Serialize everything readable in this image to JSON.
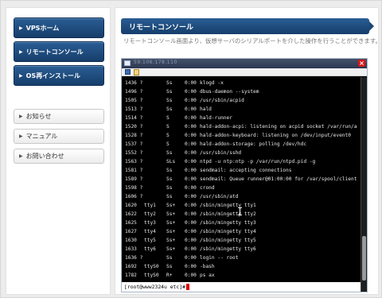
{
  "sidebar": {
    "nav": [
      {
        "label": "VPSホーム"
      },
      {
        "label": "リモートコンソール"
      },
      {
        "label": "OS再インストール"
      }
    ],
    "sub": [
      {
        "label": "お知らせ"
      },
      {
        "label": "マニュアル"
      },
      {
        "label": "お問い合わせ"
      }
    ]
  },
  "main": {
    "title": "リモートコンソール",
    "description": "リモートコンソール画面より、仮想サーバのシリアルポートを介した操作を行うことができます。"
  },
  "console": {
    "window_title": "59.106.178.110",
    "processes": [
      {
        "pid": "1436 ?",
        "tty": "",
        "stat": "Ss",
        "time": "0:00",
        "cmd": "klogd -x"
      },
      {
        "pid": "1496 ?",
        "tty": "",
        "stat": "Ss",
        "time": "0:00",
        "cmd": "dbus-daemon --system"
      },
      {
        "pid": "1505 ?",
        "tty": "",
        "stat": "Ss",
        "time": "0:00",
        "cmd": "/usr/sbin/acpid"
      },
      {
        "pid": "1513 ?",
        "tty": "",
        "stat": "Ss",
        "time": "0:00",
        "cmd": "hald"
      },
      {
        "pid": "1514 ?",
        "tty": "",
        "stat": "S",
        "time": "0:00",
        "cmd": "hald-runner"
      },
      {
        "pid": "1520 ?",
        "tty": "",
        "stat": "S",
        "time": "0:00",
        "cmd": "hald-addon-acpi: listening on acpid socket /var/run/a"
      },
      {
        "pid": "1528 ?",
        "tty": "",
        "stat": "S",
        "time": "0:00",
        "cmd": "hald-addon-keyboard: listening on /dev/input/event0"
      },
      {
        "pid": "1537 ?",
        "tty": "",
        "stat": "S",
        "time": "0:00",
        "cmd": "hald-addon-storage: polling /dev/hdc"
      },
      {
        "pid": "1552 ?",
        "tty": "",
        "stat": "Ss",
        "time": "0:00",
        "cmd": "/usr/sbin/sshd"
      },
      {
        "pid": "1563 ?",
        "tty": "",
        "stat": "SLs",
        "time": "0:00",
        "cmd": "ntpd -u ntp:ntp -p /var/run/ntpd.pid -g"
      },
      {
        "pid": "1581 ?",
        "tty": "",
        "stat": "Ss",
        "time": "0:00",
        "cmd": "sendmail: accepting connections"
      },
      {
        "pid": "1589 ?",
        "tty": "",
        "stat": "Ss",
        "time": "0:00",
        "cmd": "sendmail: Queue runner@01:00:00 for /var/spool/client"
      },
      {
        "pid": "1598 ?",
        "tty": "",
        "stat": "Ss",
        "time": "0:00",
        "cmd": "crond"
      },
      {
        "pid": "1606 ?",
        "tty": "",
        "stat": "Ss",
        "time": "0:00",
        "cmd": "/usr/sbin/atd"
      },
      {
        "pid": "1620",
        "tty": "tty1",
        "stat": "Ss+",
        "time": "0:00",
        "cmd": "/sbin/mingetty tty1"
      },
      {
        "pid": "1622",
        "tty": "tty2",
        "stat": "Ss+",
        "time": "0:00",
        "cmd": "/sbin/mingetty tty2"
      },
      {
        "pid": "1625",
        "tty": "tty3",
        "stat": "Ss+",
        "time": "0:00",
        "cmd": "/sbin/mingetty tty3"
      },
      {
        "pid": "1627",
        "tty": "tty4",
        "stat": "Ss+",
        "time": "0:00",
        "cmd": "/sbin/mingetty tty4"
      },
      {
        "pid": "1630",
        "tty": "tty5",
        "stat": "Ss+",
        "time": "0:00",
        "cmd": "/sbin/mingetty tty5"
      },
      {
        "pid": "1633",
        "tty": "tty6",
        "stat": "Ss+",
        "time": "0:00",
        "cmd": "/sbin/mingetty tty6"
      },
      {
        "pid": "1636 ?",
        "tty": "",
        "stat": "Ss",
        "time": "0:00",
        "cmd": "login -- root"
      },
      {
        "pid": "1692",
        "tty": "ttyS0",
        "stat": "Ss",
        "time": "0:00",
        "cmd": "-bash"
      },
      {
        "pid": "1782",
        "tty": "ttyS0",
        "stat": "R+",
        "time": "0:00",
        "cmd": "ps ax"
      }
    ],
    "prompt": "[root@www2324u etc]#"
  },
  "colors": {
    "nav_blue": "#1d4677",
    "close_red": "#d81818"
  }
}
